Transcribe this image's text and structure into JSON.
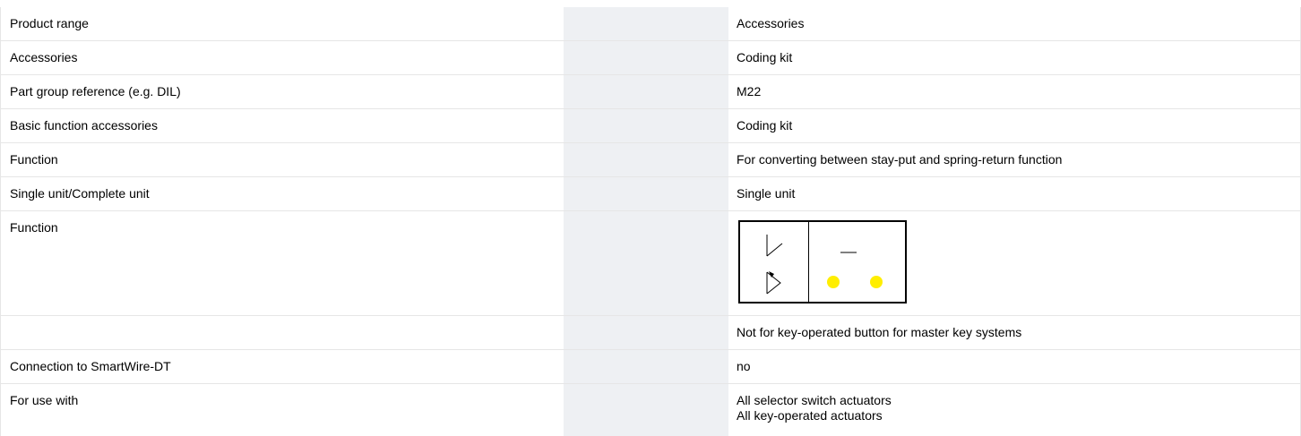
{
  "colors": {
    "heading": "#0060b0",
    "stripe": "#eef0f3",
    "grid_line": "#e6e6e6",
    "indicator_dot": "#ffee00"
  },
  "rows": [
    {
      "label": "Product range",
      "value": "Accessories"
    },
    {
      "label": "Accessories",
      "value": "Coding kit"
    },
    {
      "label": "Part group reference (e.g. DIL)",
      "value": "M22"
    },
    {
      "label": "Basic function accessories",
      "value": "Coding kit"
    },
    {
      "label": "Function",
      "value": "For converting between stay-put and spring-return function"
    },
    {
      "label": "Single unit/Complete unit",
      "value": "Single unit"
    },
    {
      "label": "Function",
      "value_icon": "function-symbol-diagram"
    },
    {
      "label": "",
      "value": "Not for key-operated button for master key systems"
    },
    {
      "label": "Connection to SmartWire-DT",
      "value": "no"
    },
    {
      "label": "For use with",
      "value": "All selector switch actuators",
      "value_line2": "All key-operated actuators"
    }
  ]
}
